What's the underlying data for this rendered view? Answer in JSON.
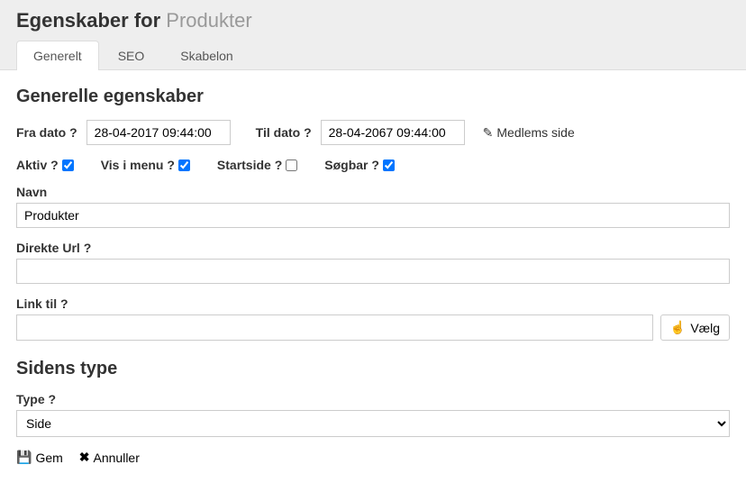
{
  "header": {
    "title_prefix": "Egenskaber for",
    "title_entity": "Produkter"
  },
  "tabs": {
    "general": "Generelt",
    "seo": "SEO",
    "template": "Skabelon"
  },
  "section_general": {
    "heading": "Generelle egenskaber",
    "from_date_label": "Fra dato ?",
    "from_date_value": "28-04-2017 09:44:00",
    "to_date_label": "Til dato ?",
    "to_date_value": "28-04-2067 09:44:00",
    "member_page": "Medlems side",
    "flags": {
      "active_label": "Aktiv ?",
      "show_menu_label": "Vis i menu ?",
      "startpage_label": "Startside ?",
      "searchable_label": "Søgbar ?"
    },
    "name_label": "Navn",
    "name_value": "Produkter",
    "direct_url_label": "Direkte Url ?",
    "direct_url_value": "",
    "link_to_label": "Link til ?",
    "link_to_value": "",
    "choose_label": "Vælg"
  },
  "section_type": {
    "heading": "Sidens type",
    "type_label": "Type ?",
    "type_value": "Side"
  },
  "footer": {
    "save": "Gem",
    "cancel": "Annuller"
  },
  "icons": {
    "edit": "✎",
    "hand": "☝",
    "save": "💾",
    "close": "✖"
  }
}
